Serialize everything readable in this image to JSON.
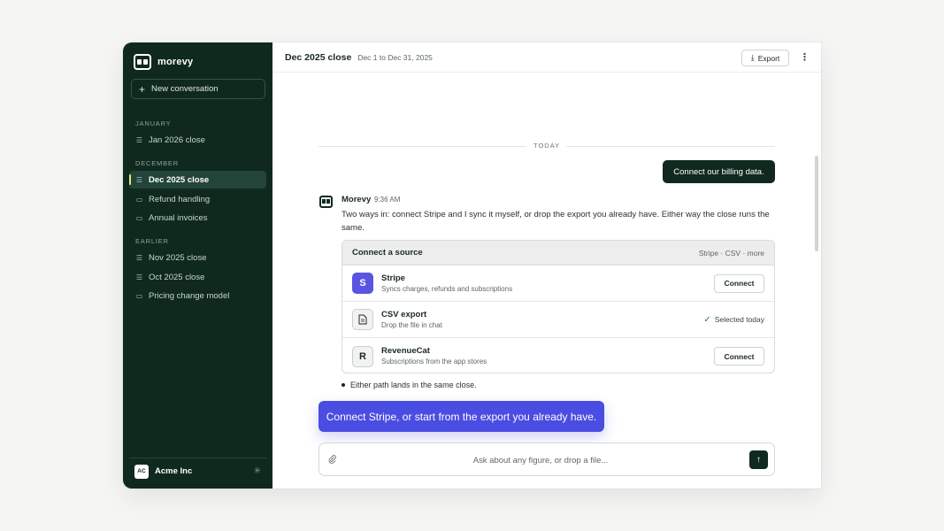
{
  "app": {
    "name": "morevy"
  },
  "sidebar": {
    "new_conversation": "New conversation",
    "sections": [
      {
        "label": "JANUARY",
        "items": [
          {
            "label": "Jan 2026 close",
            "icon": "lines-icon"
          }
        ]
      },
      {
        "label": "DECEMBER",
        "items": [
          {
            "label": "Dec 2025 close",
            "icon": "lines-icon",
            "active": true
          },
          {
            "label": "Refund handling",
            "icon": "chat-icon"
          },
          {
            "label": "Annual invoices",
            "icon": "chat-icon"
          }
        ]
      },
      {
        "label": "EARLIER",
        "items": [
          {
            "label": "Nov 2025 close",
            "icon": "lines-icon"
          },
          {
            "label": "Oct 2025 close",
            "icon": "lines-icon"
          },
          {
            "label": "Pricing change model",
            "icon": "chat-icon"
          }
        ]
      }
    ],
    "footer": {
      "avatar_initials": "AC",
      "org_name": "Acme Inc"
    }
  },
  "header": {
    "title": "Dec 2025 close",
    "date_range": "Dec 1 to Dec 31, 2025",
    "export_label": "Export"
  },
  "chat": {
    "day_divider": "TODAY",
    "user_message": "Connect our billing data.",
    "bot": {
      "name": "Morevy",
      "time": "9:36 AM",
      "text": "Two ways in: connect Stripe and I sync it myself, or drop the export you already have. Either way the close runs the same."
    },
    "source_card": {
      "title": "Connect a source",
      "meta": "Stripe · CSV · more",
      "sources": [
        {
          "letter": "S",
          "name": "Stripe",
          "desc": "Syncs charges, refunds and subscriptions",
          "action": "Connect"
        },
        {
          "name": "CSV export",
          "desc": "Drop the file in chat",
          "status": "Selected today"
        },
        {
          "letter": "R",
          "name": "RevenueCat",
          "desc": "Subscriptions from the app stores",
          "action": "Connect"
        }
      ]
    },
    "note": "Either path lands in the same close.",
    "suggestion": "Connect Stripe, or start from the export you already have."
  },
  "composer": {
    "placeholder": "Ask about any figure, or drop a file..."
  },
  "colors": {
    "sidebar_bg": "#10291f",
    "accent": "#4a4de2",
    "stripe": "#5b54e0"
  }
}
